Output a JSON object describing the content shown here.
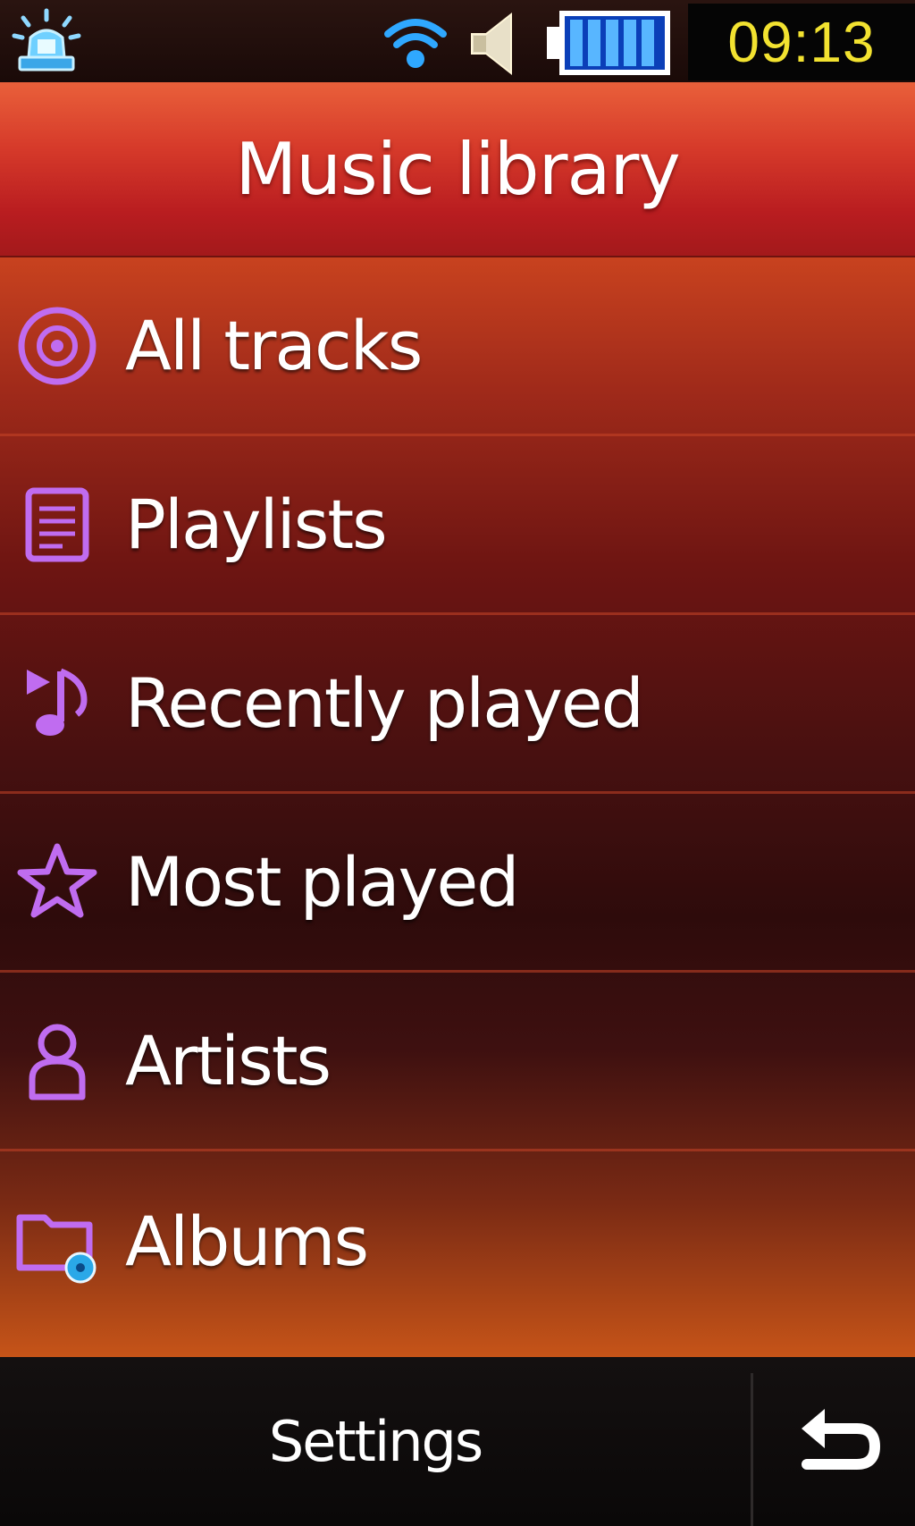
{
  "status_bar": {
    "icons": [
      "alert-siren-icon",
      "wifi-icon",
      "speaker-icon",
      "battery-icon"
    ],
    "time": "09:13",
    "colors": {
      "clock_text": "#f2e230",
      "wifi": "#2fa8ff",
      "battery": "#2a7dff"
    }
  },
  "title": "Music library",
  "menu": {
    "items": [
      {
        "label": "All tracks",
        "icon": "disc-icon"
      },
      {
        "label": "Playlists",
        "icon": "playlist-icon"
      },
      {
        "label": "Recently played",
        "icon": "recent-music-note-icon"
      },
      {
        "label": "Most played",
        "icon": "star-icon"
      },
      {
        "label": "Artists",
        "icon": "person-icon"
      },
      {
        "label": "Albums",
        "icon": "album-folder-icon"
      }
    ],
    "icon_color": "#c06cf0"
  },
  "bottom_bar": {
    "settings_label": "Settings",
    "back_icon": "back-arrow-icon"
  }
}
